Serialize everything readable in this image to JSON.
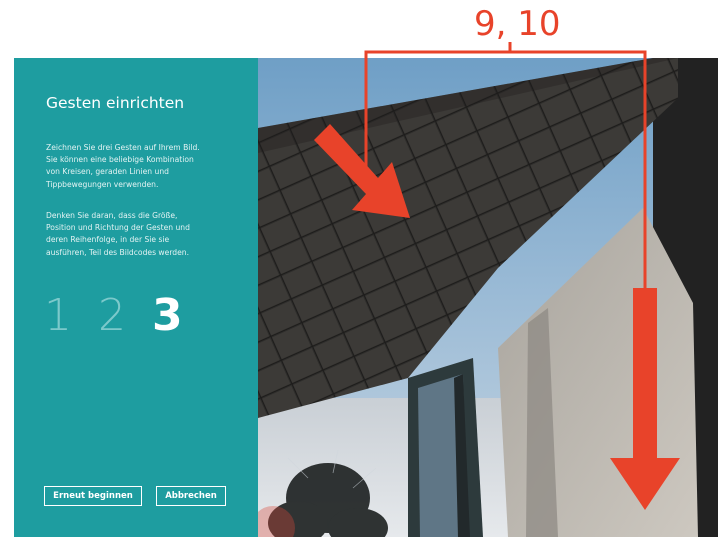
{
  "callout": {
    "label": "9, 10",
    "color": "#e8432a"
  },
  "panel": {
    "title": "Gesten einrichten",
    "paragraph1_lines": [
      "Zeichnen Sie drei Gesten auf Ihrem Bild.",
      "Sie können eine beliebige Kombination",
      "von Kreisen, geraden Linien und",
      "Tippbewegungen verwenden."
    ],
    "paragraph2_lines": [
      "Denken Sie daran, dass die Größe,",
      "Position und Richtung der Gesten und",
      "deren Reihenfolge, in der Sie sie",
      "ausführen, Teil des Bildcodes werden."
    ],
    "steps": [
      "1",
      "2",
      "3"
    ],
    "active_step": "3",
    "background_color": "#1e9da0"
  },
  "buttons": {
    "restart_label": "Erneut beginnen",
    "cancel_label": "Abbrechen"
  },
  "image": {
    "description_icon": "house-roof-photo"
  }
}
